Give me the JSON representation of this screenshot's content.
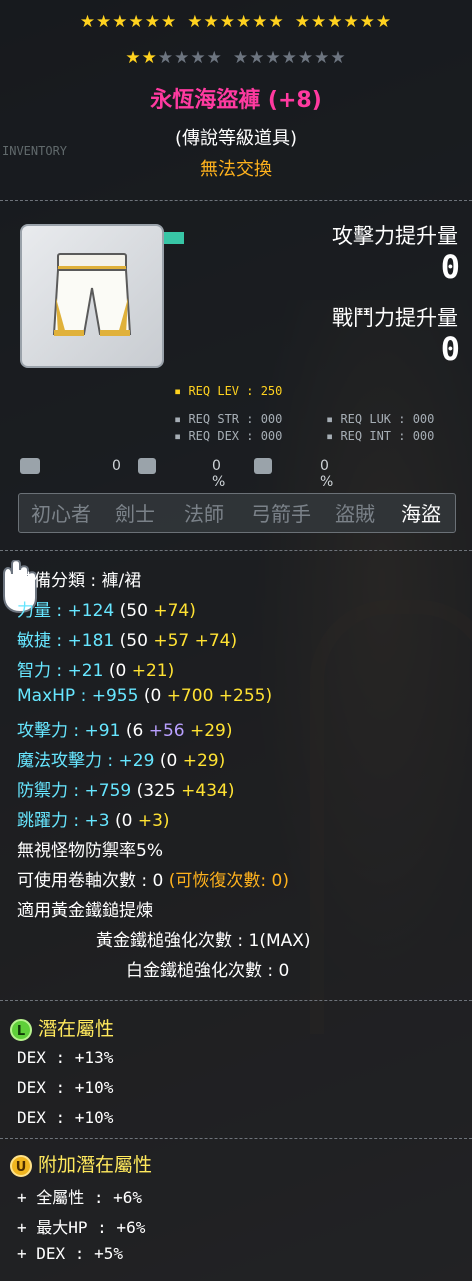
{
  "header": {
    "star_groups_top": [
      "★★★★★★",
      "★★★★★★",
      "★★★★★★"
    ],
    "stars_second_on": "★★",
    "stars_second_off_a": "★★★★",
    "stars_second_off_b": "★★★★★★★",
    "title": "永恆海盜褲 (+8)",
    "grade": "(傳說等級道具)",
    "trade": "無法交換",
    "inventory_label": "INVENTORY"
  },
  "gains": {
    "attack_label": "攻擊力提升量",
    "attack_value": "0",
    "battle_label": "戰鬥力提升量",
    "battle_value": "0"
  },
  "requirements": {
    "lev": "REQ LEV : 250",
    "str": "REQ STR : 000",
    "luk": "REQ LUK : 000",
    "dex": "REQ DEX : 000",
    "int": "REQ INT : 000"
  },
  "small_values": [
    "0",
    "0 %",
    "0 %"
  ],
  "jobs": [
    "初心者",
    "劍士",
    "法師",
    "弓箭手",
    "盜賊",
    "海盜"
  ],
  "active_job": "海盜",
  "stats": {
    "category": "裝備分類 : 褲/裙",
    "str": {
      "label": "力量 :",
      "total": "+124",
      "open": "(50",
      "b1": "+74)"
    },
    "dex": {
      "label": "敏捷 :",
      "total": "+181",
      "open": "(50",
      "b1": "+57",
      "b2": "+74)"
    },
    "int": {
      "label": "智力 :",
      "total": "+21",
      "open": "(0",
      "b1": "+21)"
    },
    "hp": {
      "label": "MaxHP :",
      "total": "+955",
      "open": "(0",
      "b1": "+700",
      "b2": "+255)"
    },
    "atk": {
      "label": "攻擊力 :",
      "total": "+91",
      "open": "(6",
      "b1": "+56",
      "b2": "+29)"
    },
    "matk": {
      "label": "魔法攻擊力 :",
      "total": "+29",
      "open": "(0",
      "b1": "+29)"
    },
    "def": {
      "label": "防禦力 :",
      "total": "+759",
      "open": "(325",
      "b1": "+434)"
    },
    "jump": {
      "label": "跳躍力 :",
      "total": "+3",
      "open": "(0",
      "b1": "+3)"
    },
    "ignore_def": "無視怪物防禦率5%",
    "scroll": "可使用卷軸次數 : 0",
    "scroll_recover": "(可恢復次數: 0)",
    "hammer_note": "適用黃金鐵鎚提煉",
    "gold_hammer": "黃金鐵槌強化次數 : 1(MAX)",
    "plat_hammer": "白金鐵槌強化次數 : 0"
  },
  "potential": {
    "badge": "L",
    "title": "潛在屬性",
    "lines": [
      "DEX : +13%",
      "DEX : +10%",
      "DEX : +10%"
    ]
  },
  "additional_potential": {
    "badge": "U",
    "title": "附加潛在屬性",
    "lines": [
      "+ 全屬性 : +6%",
      "+ 最大HP : +6%",
      "+ DEX : +5%"
    ]
  },
  "colors": {
    "title": "#ff3aa0",
    "trade": "#ffb21d",
    "star_on": "#ffd21f",
    "stat_label": "#67e6ff",
    "bonus_yellow": "#ffe233",
    "bonus_purple": "#b9a0ff",
    "potential_head": "#ffe95d"
  },
  "icons": [
    "pants-item-icon",
    "swap-icon",
    "upgrade-icon",
    "shield-icon",
    "glove-cursor-icon"
  ]
}
